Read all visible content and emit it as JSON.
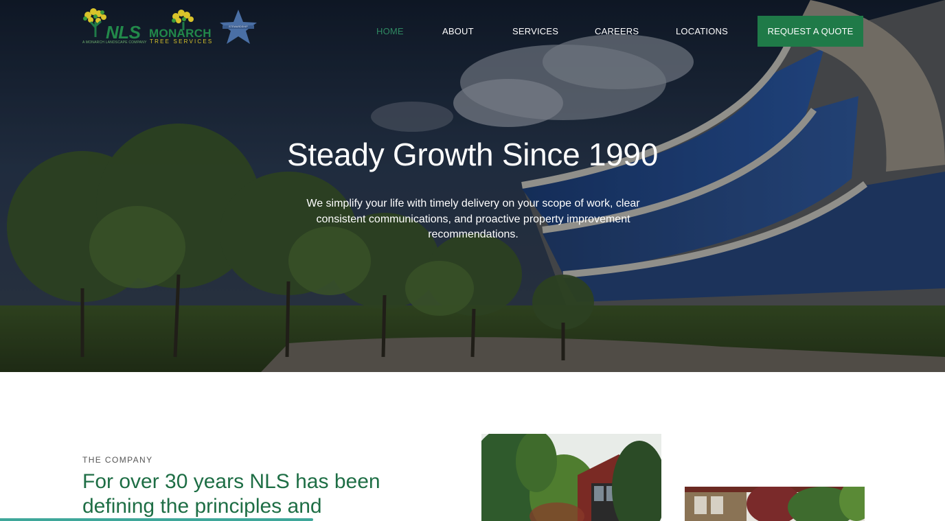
{
  "logos": {
    "nls_text": "NLS",
    "nls_tagline": "A MONARCH LANDSCAPE COMPANY",
    "monarch_text": "MONARCH",
    "monarch_sub": "TREE SERVICES",
    "star_badge_text": "STEWARDSHIP"
  },
  "nav": {
    "items": [
      {
        "label": "HOME",
        "active": true
      },
      {
        "label": "ABOUT",
        "active": false
      },
      {
        "label": "SERVICES",
        "active": false
      },
      {
        "label": "CAREERS",
        "active": false
      },
      {
        "label": "LOCATIONS",
        "active": false
      }
    ],
    "cta_label": "REQUEST A QUOTE"
  },
  "hero": {
    "title": "Steady Growth Since 1990",
    "subtitle": "We simplify your life with timely delivery on your scope of work, clear consistent communications, and proactive property improvement recommendations."
  },
  "company": {
    "eyebrow": "THE COMPANY",
    "heading": "For over 30 years NLS has been defining the principles and"
  },
  "colors": {
    "brand_green": "#1f7a48",
    "heading_green": "#1e6e45",
    "active_nav": "#2f8a62",
    "logo_yellow": "#d9c32a",
    "star_blue": "#4a6fa5",
    "scroll_accent": "#3fa79a"
  },
  "icons": [
    "nls-tree-logo",
    "monarch-tree-logo",
    "star-badge-icon"
  ]
}
